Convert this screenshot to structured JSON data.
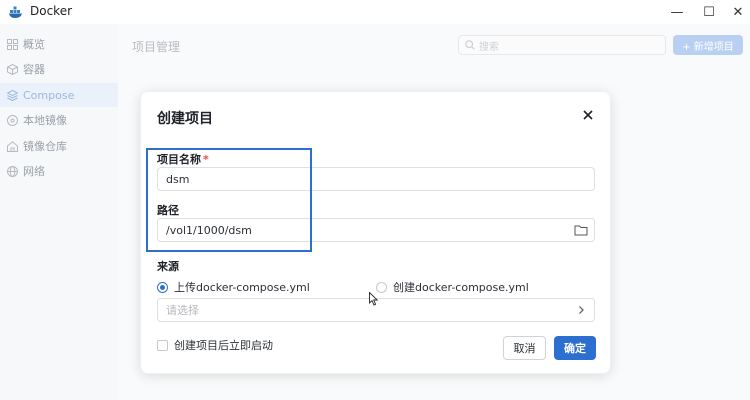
{
  "window": {
    "title": "Docker",
    "controls": {
      "minimize": "—",
      "maximize": "☐",
      "close": "✕"
    }
  },
  "sidebar": {
    "items": [
      {
        "label": "概览",
        "icon": "grid-icon",
        "active": false
      },
      {
        "label": "容器",
        "icon": "cube-icon",
        "active": false
      },
      {
        "label": "Compose",
        "icon": "layers-icon",
        "active": true
      },
      {
        "label": "本地镜像",
        "icon": "disc-icon",
        "active": false
      },
      {
        "label": "镜像仓库",
        "icon": "home-icon",
        "active": false
      },
      {
        "label": "网络",
        "icon": "globe-icon",
        "active": false
      }
    ]
  },
  "main": {
    "page_title": "项目管理",
    "search": {
      "placeholder": "搜索"
    },
    "new_button": "+ 新增项目"
  },
  "dialog": {
    "title": "创建项目",
    "project_name": {
      "label": "项目名称",
      "required_mark": "*",
      "value": "dsm"
    },
    "path": {
      "label": "路径",
      "value": "/vol1/1000/dsm"
    },
    "source": {
      "label": "来源",
      "options": [
        {
          "label": "上传docker-compose.yml",
          "selected": true
        },
        {
          "label": "创建docker-compose.yml",
          "selected": false
        }
      ],
      "select_placeholder": "请选择"
    },
    "start_after_create": {
      "label": "创建项目后立即启动",
      "checked": false
    },
    "cancel_button": "取消",
    "ok_button": "确定"
  },
  "colors": {
    "accent": "#2d6fd0",
    "highlight_border": "#2d6fd0",
    "required": "#e5484d"
  }
}
